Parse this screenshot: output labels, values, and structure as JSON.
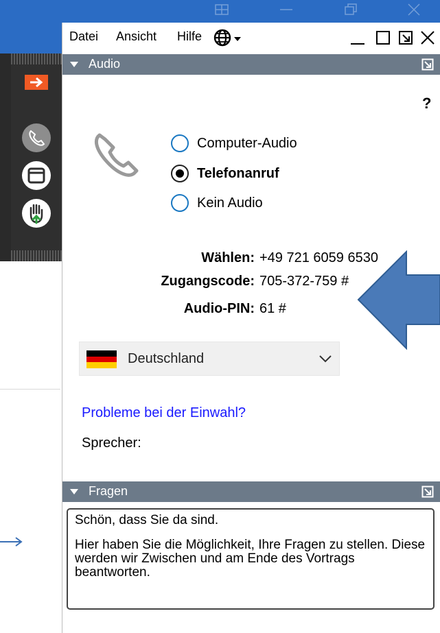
{
  "menu": {
    "datei": "Datei",
    "ansicht": "Ansicht",
    "hilfe": "Hilfe"
  },
  "audio": {
    "header": "Audio",
    "help": "?",
    "options": {
      "computer": "Computer-Audio",
      "telefon": "Telefonanruf",
      "kein": "Kein Audio"
    },
    "selected": "telefon",
    "dial": {
      "waehlen_label": "Wählen:",
      "waehlen_value": "+49 721 6059 6530",
      "zugang_label": "Zugangscode:",
      "zugang_value": "705-372-759 #",
      "pin_label": "Audio-PIN:",
      "pin_value": "61 #"
    },
    "country": "Deutschland",
    "problem_link": "Probleme bei der Einwahl?",
    "speaker_label": "Sprecher:"
  },
  "fragen": {
    "header": "Fragen",
    "greeting": "Schön, dass Sie da sind.",
    "info": "Hier haben Sie die Möglichkeit, Ihre Fragen zu stellen. Diese werden wir Zwischen und am Ende des Vortrags beantworten."
  },
  "colors": {
    "section_header": "#6c7a89",
    "accent_orange": "#f05a24",
    "arrow_blue": "#4a7ab8",
    "link": "#1a1aff",
    "bg_blue": "#2b6cc4"
  }
}
